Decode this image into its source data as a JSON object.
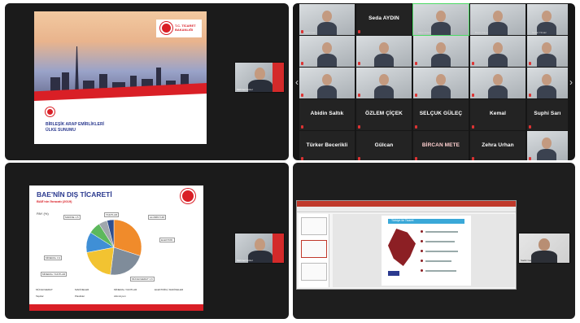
{
  "quad1": {
    "ministry": [
      "T.C. TİCARET",
      "BAKANLIĞI"
    ],
    "title": [
      "BİRLEŞİK ARAP EMİRLİKLERİ",
      "ÜLKE SUNUMU"
    ],
    "cam_name": "Mehmet Güzel"
  },
  "grid": {
    "top_names": [
      "Sadık Gen",
      "Seda AYDIN",
      "Mete Arıkan",
      "Burcu Kaya",
      "Sedat Yılmaz"
    ],
    "cells": [
      {
        "name": "Seda AYDIN"
      },
      {
        "name": "Abidin Saltık"
      },
      {
        "name": "ÖZLEM ÇİÇEK"
      },
      {
        "name": "SELÇUK GÜLEÇ"
      },
      {
        "name": "Kemal"
      },
      {
        "name": "Suphi Sarı"
      },
      {
        "name": "Türker Becerikli"
      },
      {
        "name": "Gülcan"
      },
      {
        "name": "BİRCAN METE"
      },
      {
        "name": "Zehra Urhan"
      }
    ]
  },
  "quad3": {
    "title": "BAE'NİN DIŞ TİCARETİ",
    "subtitle": "BAE'nin İhracatı (2019)",
    "pay": "PAY (%)",
    "labels": [
      "MAKİNE 1,5",
      "TAŞITLAR",
      "ALÜMİNYUM",
      "ELEKTRİK",
      "MÜCEVHERAT 1,6",
      "MİNERAL YAKITLAR",
      "MİNERAL 3,3"
    ],
    "legend": [
      "MÜCEVHERAT",
      "MAKİNELER",
      "MİNERAL YAKITLAR",
      "ELEKTRİKLİ MAKİNELER",
      "Taşıtlar",
      "Plastikler",
      "Alüminyum"
    ],
    "cam_name": "Mehmet Güzel"
  },
  "quad4": {
    "slide_title": "Türkiye ile Ticaret",
    "cam_name": "Sadık Gen"
  },
  "chart_data": {
    "type": "pie",
    "title": "BAE'NİN DIŞ TİCARETİ",
    "subtitle": "BAE'nin İhracatı (2019)",
    "categories": [
      "MAKİNELER",
      "MÜCEVHERAT",
      "MİNERAL YAKITLAR",
      "ELEKTRİKLİ MAKİNELER",
      "Taşıtlar",
      "Plastikler",
      "Alüminyum"
    ],
    "values": [
      30,
      22,
      20,
      12,
      7,
      5,
      4
    ],
    "colors": [
      "#f08b2b",
      "#7f8c9a",
      "#f2c331",
      "#3f8fd6",
      "#5cb85c",
      "#a0a7ad",
      "#2f4f8f"
    ]
  }
}
